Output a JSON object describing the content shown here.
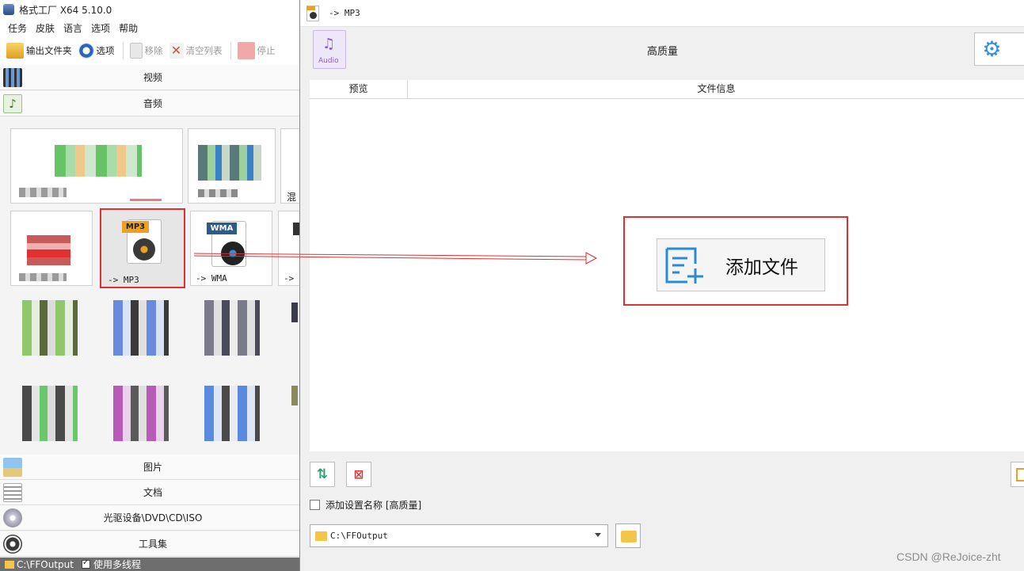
{
  "main_window": {
    "title": "格式工厂 X64 5.10.0",
    "menu": [
      "任务",
      "皮肤",
      "语言",
      "选项",
      "帮助"
    ],
    "toolbar": {
      "output_folder": "输出文件夹",
      "options": "选项",
      "remove": "移除",
      "clear_list": "清空列表",
      "stop": "停止"
    },
    "categories": {
      "video": "视频",
      "audio": "音频",
      "image": "图片",
      "document": "文档",
      "rom": "光驱设备\\DVD\\CD\\ISO",
      "tools": "工具集"
    },
    "tiles": {
      "partial_label": "混",
      "mp3_badge": "MP3",
      "mp3_caption": "-> MP3",
      "wma_badge": "WMA",
      "wma_caption": "-> WMA",
      "partial_caption": "->"
    },
    "status": {
      "output_path": "C:\\FFOutput",
      "multithread": "使用多线程"
    }
  },
  "dialog": {
    "title": "-> MP3",
    "audio_icon_label": "Audio",
    "quality": "高质量",
    "columns": [
      "预览",
      "文件信息"
    ],
    "add_file": "添加文件",
    "checkbox_label": "添加设置名称 [高质量]",
    "output_path": "C:\\FFOutput"
  },
  "watermark": "CSDN @ReJoice-zht",
  "colors": {
    "highlight": "#e03030",
    "accent_blue": "#2f8fe0",
    "folder": "#f3c64a",
    "statusbar": "#6e6e6e"
  }
}
